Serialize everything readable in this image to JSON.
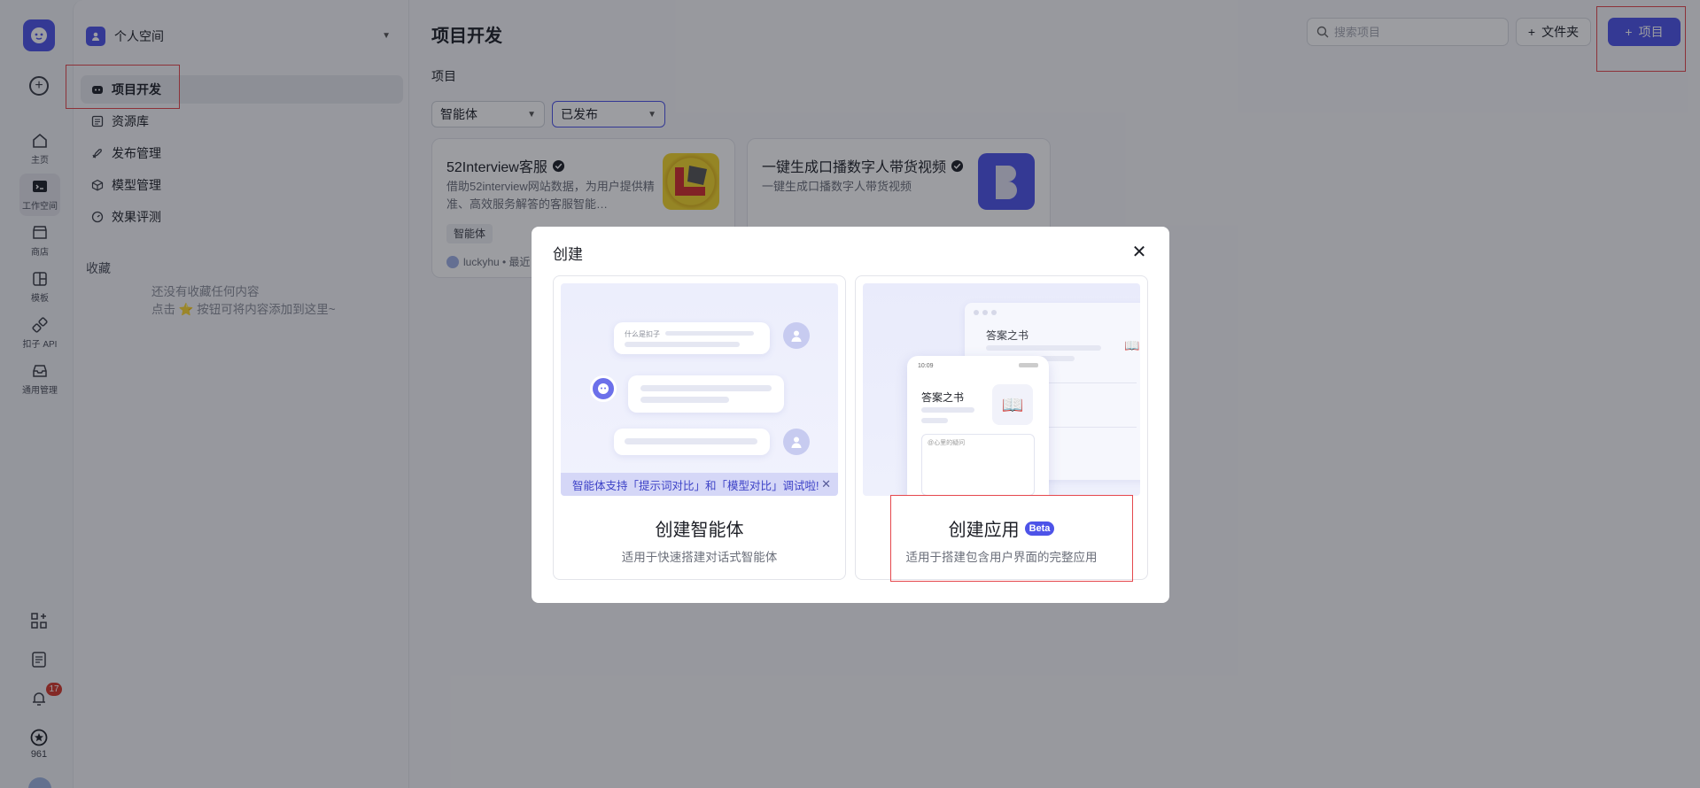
{
  "rail": {
    "items": [
      {
        "label": "主页",
        "icon": "home-icon"
      },
      {
        "label": "工作空间",
        "icon": "terminal-icon"
      },
      {
        "label": "商店",
        "icon": "store-icon"
      },
      {
        "label": "模板",
        "icon": "template-icon"
      },
      {
        "label": "扣子 API",
        "icon": "api-icon"
      },
      {
        "label": "通用管理",
        "icon": "inbox-icon"
      }
    ],
    "notification_count": "17",
    "credits": "961"
  },
  "sidebar": {
    "space_name": "个人空间",
    "nav": [
      {
        "label": "项目开发"
      },
      {
        "label": "资源库"
      },
      {
        "label": "发布管理"
      },
      {
        "label": "模型管理"
      },
      {
        "label": "效果评测"
      }
    ],
    "favorites_title": "收藏",
    "favorites_empty_line1": "还没有收藏任何内容",
    "favorites_empty_line2": "点击 ⭐ 按钮可将内容添加到这里~"
  },
  "main": {
    "title": "项目开发",
    "section": "项目",
    "search_placeholder": "搜索项目",
    "folder_button": "文件夹",
    "project_button": "项目",
    "filters": [
      {
        "value": "智能体"
      },
      {
        "value": "已发布"
      }
    ],
    "cards": [
      {
        "title": "52Interview客服",
        "description": "借助52interview网站数据，为用户提供精准、高效服务解答的客服智能…",
        "tag": "智能体",
        "author": "luckyhu • 最近"
      },
      {
        "title": "一键生成口播数字人带货视频",
        "description": "一键生成口播数字人带货视频",
        "tag": "",
        "author": ""
      }
    ]
  },
  "modal": {
    "title": "创建",
    "close_icon": "close-icon",
    "options": [
      {
        "title": "创建智能体",
        "description": "适用于快速搭建对话式智能体",
        "banner": "智能体支持「提示词对比」和「模型对比」调试啦!",
        "bubble_text": "什么是扣子"
      },
      {
        "title": "创建应用",
        "badge": "Beta",
        "description": "适用于搭建包含用户界面的完整应用",
        "preview_time": "10:09",
        "preview_app_title": "答案之书",
        "preview_input_placeholder": "@心里的疑问"
      }
    ]
  },
  "colors": {
    "accent": "#4d53e8",
    "highlight_box": "#e5484d"
  }
}
